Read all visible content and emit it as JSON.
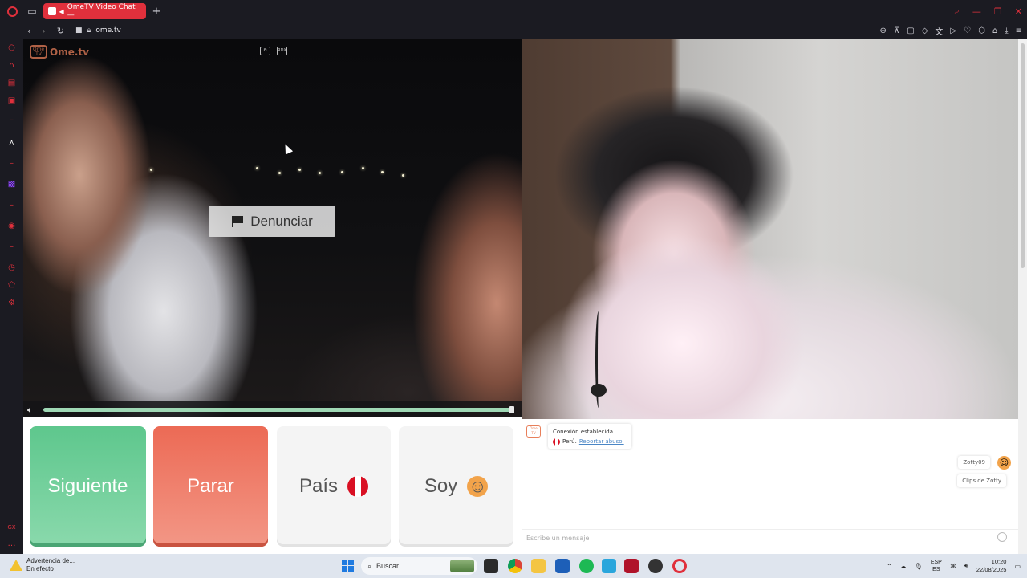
{
  "browser": {
    "tab_title": "OmeTV Video Chat —",
    "url": "ome.tv",
    "accent": "#e0303c"
  },
  "video": {
    "logo_text": "Ome.tv",
    "logo_badge": "Ome TV",
    "report_label": "Denunciar",
    "volume_level": 1.0,
    "top_icons": [
      "picture-in-picture-icon",
      "settings-icon"
    ]
  },
  "controls": {
    "next_label": "Siguiente",
    "stop_label": "Parar",
    "country_label": "País",
    "gender_label": "Soy",
    "colors": {
      "next": "#5ec78d",
      "stop": "#ec6a55"
    }
  },
  "chat": {
    "system_line1": "Conexión establecida.",
    "system_country": "Perú.",
    "report_link": "Reportar abuso.",
    "my_messages": [
      "Zotty09",
      "Clips de Zotty"
    ],
    "input_placeholder": "Escribe un mensaje"
  },
  "taskbar": {
    "warning_title": "Advertencia de...",
    "warning_sub": "En efecto",
    "search_placeholder": "Buscar",
    "lang_top": "ESP",
    "lang_bottom": "ES",
    "time": "10:20",
    "date": "22/08/2025"
  }
}
